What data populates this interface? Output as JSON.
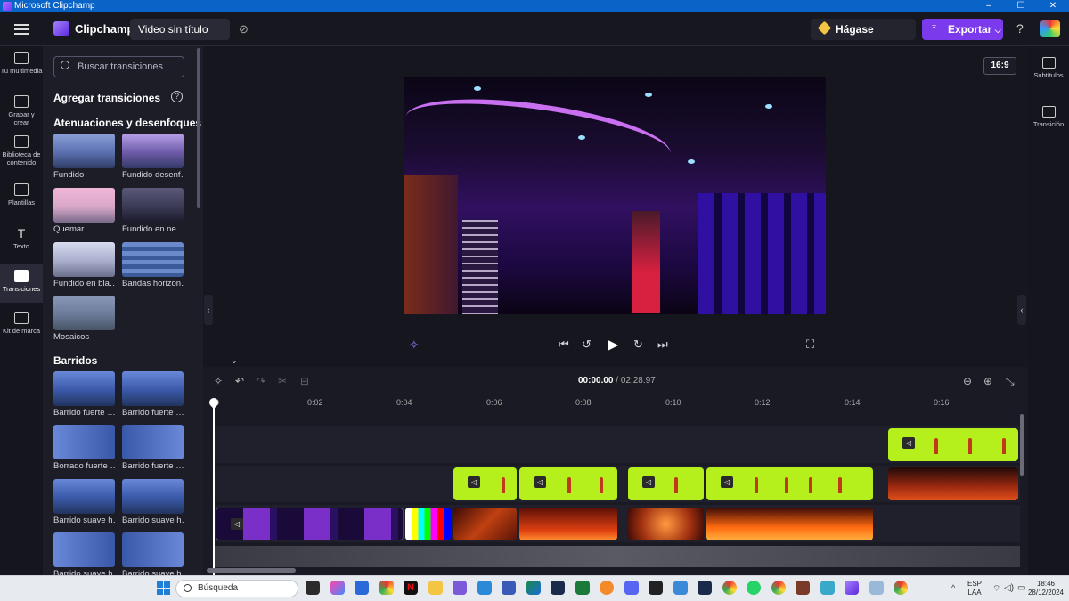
{
  "window": {
    "title": "Microsoft Clipchamp",
    "controls": [
      "–",
      "☐",
      "✕"
    ]
  },
  "appbar": {
    "brand": "Clipchamp",
    "video_title": "Video sin título",
    "premium_label": "Hágase Premium",
    "export_label": "Exportar",
    "export_caret": "⌵",
    "help": "?"
  },
  "left_rail": {
    "items": [
      {
        "label": "Tu multimedia",
        "icon": "folder-icon"
      },
      {
        "label": "Grabar y crear",
        "icon": "camera-icon"
      },
      {
        "label": "Biblioteca de contenido",
        "icon": "library-icon"
      },
      {
        "label": "Plantillas",
        "icon": "templates-icon"
      },
      {
        "label": "Texto",
        "icon": "text-icon"
      },
      {
        "label": "Transiciones",
        "icon": "transitions-icon",
        "active": true
      },
      {
        "label": "Kit de marca",
        "icon": "brand-kit-icon"
      }
    ]
  },
  "panel": {
    "search_placeholder": "Buscar transiciones",
    "heading": "Agregar transiciones",
    "help": "?",
    "sections": [
      {
        "title": "Atenuaciones y desenfoques",
        "items": [
          "Fundido",
          "Fundido desenf…",
          "Quemar",
          "Fundido en ne…",
          "Fundido en bla…",
          "Bandas horizon…",
          "Mosaicos"
        ]
      },
      {
        "title": "Barridos",
        "items": [
          "Barrido fuerte …",
          "Barrido fuerte …",
          "Borrado fuerte …",
          "Barrido fuerte …",
          "Barrido suave h…",
          "Barrido suave h…",
          "Barrido suave h…",
          "Barrido suave h…"
        ]
      }
    ]
  },
  "stage": {
    "aspect_ratio": "16:9"
  },
  "right_rail": {
    "items": [
      {
        "label": "Subtítulos",
        "icon": "captions-icon"
      },
      {
        "label": "Transición",
        "icon": "transition-icon"
      }
    ]
  },
  "playback": {
    "current_time": "00:00.00",
    "separator": " / ",
    "total_time": "02:28.97"
  },
  "timeline": {
    "ruler": [
      "0",
      "0:02",
      "0:04",
      "0:06",
      "0:08",
      "0:10",
      "0:12",
      "0:14",
      "0:16"
    ]
  },
  "taskbar": {
    "search_placeholder": "Búsqueda",
    "language": "ESP",
    "language_sub": "LAA",
    "time": "18:46",
    "date": "28/12/2024"
  },
  "colors": {
    "accent": "#7c3aed",
    "green_clip": "#b6f01c",
    "titlebar": "#0a64c8",
    "premium": "#f4c542"
  }
}
